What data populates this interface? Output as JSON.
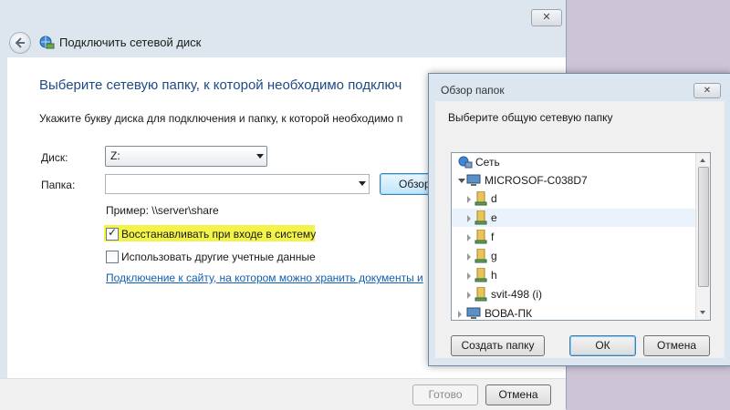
{
  "main": {
    "title": "Подключить сетевой диск",
    "close_glyph": "✕",
    "heading": "Выберите сетевую папку, к которой необходимо подключ",
    "intro": "Укажите букву диска для подключения и папку, к которой необходимо п",
    "drive_label": "Диск:",
    "drive_value": "Z:",
    "folder_label": "Папка:",
    "folder_value": "",
    "browse_label": "Обзор",
    "example": "Пример: \\\\server\\share",
    "reconnect_label": "Восстанавливать при входе в систему",
    "reconnect_checked": true,
    "credentials_label": "Использовать другие учетные данные",
    "credentials_checked": false,
    "link": "Подключение к сайту, на котором можно хранить документы и",
    "finish_label": "Готово",
    "cancel_label": "Отмена"
  },
  "browse_dialog": {
    "title": "Обзор папок",
    "close_glyph": "✕",
    "prompt": "Выберите общую сетевую папку",
    "tree": [
      {
        "label": "Сеть",
        "icon": "network-icon",
        "expander": "none"
      },
      {
        "label": "MICROSOF-C038D7",
        "icon": "computer-icon",
        "expander": "open"
      },
      {
        "label": "d",
        "icon": "share-folder-icon",
        "expander": "closed"
      },
      {
        "label": "e",
        "icon": "share-folder-icon",
        "expander": "closed",
        "selected": true
      },
      {
        "label": "f",
        "icon": "share-folder-icon",
        "expander": "closed"
      },
      {
        "label": "g",
        "icon": "share-folder-icon",
        "expander": "closed"
      },
      {
        "label": "h",
        "icon": "share-folder-icon",
        "expander": "closed"
      },
      {
        "label": "svit-498 (i)",
        "icon": "share-folder-icon",
        "expander": "closed"
      },
      {
        "label": "ВОВА-ПК",
        "icon": "computer-icon",
        "expander": "closed"
      }
    ],
    "new_folder_label": "Создать папку",
    "ok_label": "ОК",
    "cancel_label": "Отмена"
  },
  "colors": {
    "heading": "#1e4a85",
    "link": "#0f5fb3",
    "highlight": "#f3f34a"
  }
}
